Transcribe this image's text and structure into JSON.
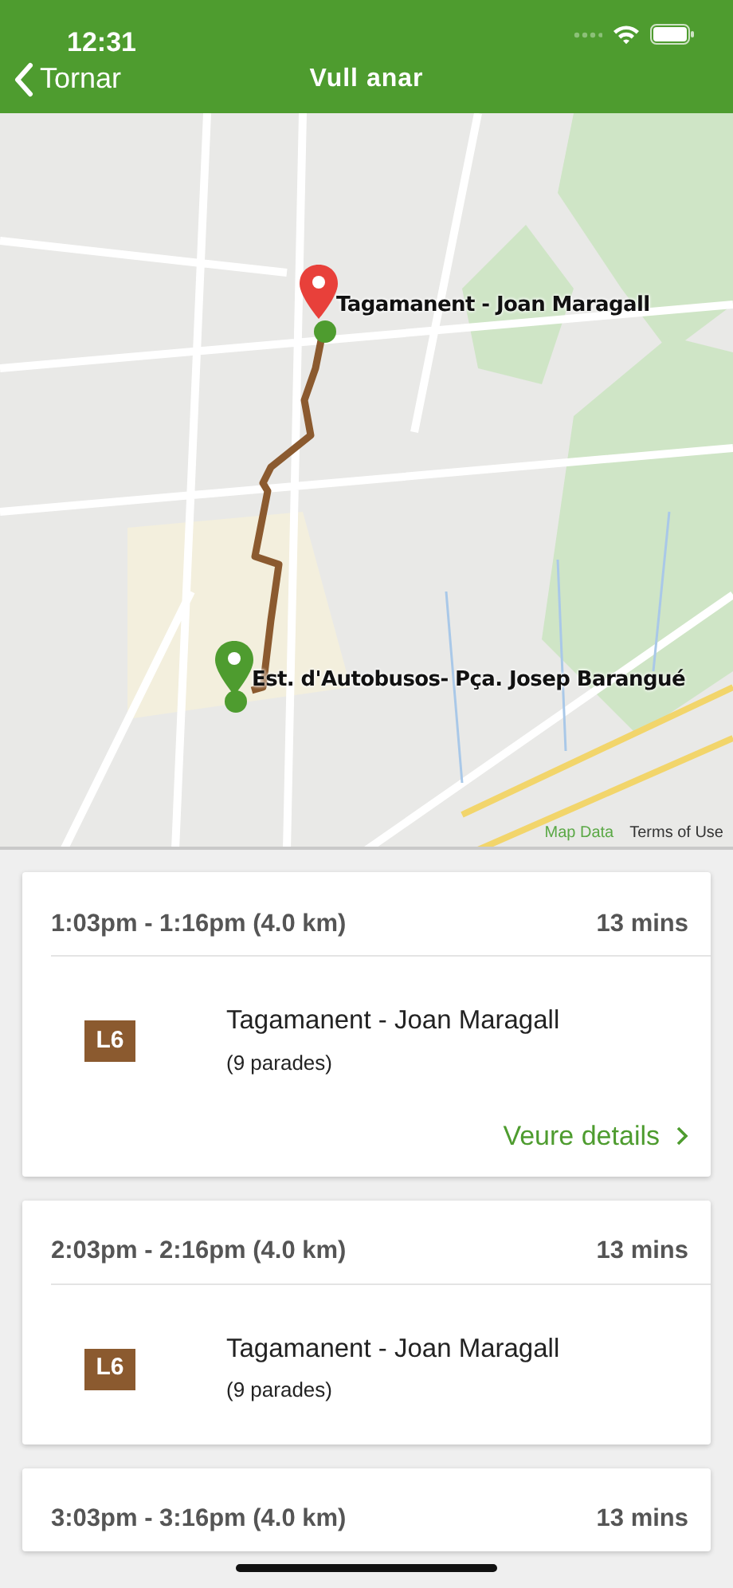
{
  "status_bar": {
    "time": "12:31"
  },
  "nav": {
    "back": "Tornar",
    "title": "Vull anar"
  },
  "map": {
    "markers": [
      {
        "kind": "destination",
        "label": "Tagamanent - Joan Maragall"
      },
      {
        "kind": "origin",
        "label": "Est. d'Autobusos- Pça. Josep Barangué"
      }
    ],
    "links": [
      "Map Data",
      "Terms of Use"
    ]
  },
  "routes": [
    {
      "times": "1:03pm - 1:16pm (4.0 km)",
      "duration": "13 mins",
      "line": "L6",
      "stop": "Tagamanent - Joan Maragall",
      "stops": "(9 parades)",
      "link": "Veure details"
    },
    {
      "times": "2:03pm - 2:16pm (4.0 km)",
      "duration": "13 mins",
      "line": "L6",
      "stop": "Tagamanent - Joan Maragall",
      "stops": "(9 parades)"
    },
    {
      "times": "3:03pm - 3:16pm (4.0 km)",
      "duration": "13 mins"
    }
  ]
}
